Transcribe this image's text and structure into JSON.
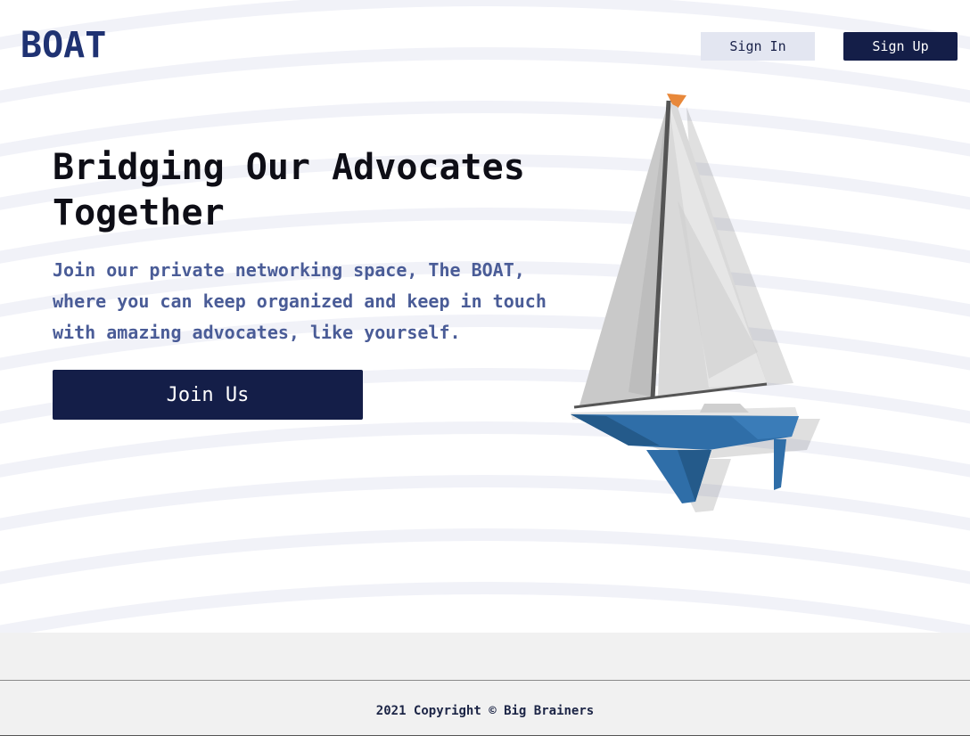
{
  "header": {
    "logo": "BOAT",
    "sign_in_label": "Sign In",
    "sign_up_label": "Sign Up"
  },
  "hero": {
    "headline": "Bridging Our Advocates Together",
    "subtext": "Join our private networking space, The BOAT, where you can keep organized and keep in touch with amazing advocates, like yourself.",
    "join_label": "Join Us",
    "illustration": "sailboat-illustration"
  },
  "footer": {
    "copyright": "2021 Copyright © Big Brainers"
  },
  "colors": {
    "brand_navy": "#141e48",
    "logo_blue": "#1f3272",
    "subtext_blue": "#4a5c97",
    "sign_in_bg": "#e3e6f1",
    "hull_blue": "#2f6ea8",
    "flag_orange": "#e8883a"
  }
}
